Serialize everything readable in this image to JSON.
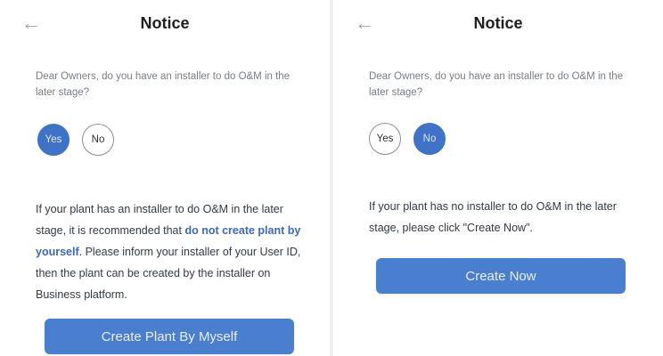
{
  "left": {
    "back_icon": "arrow-left-icon",
    "title": "Notice",
    "question": "Dear Owners, do you have an installer to do O&M in the later stage?",
    "options": {
      "yes": "Yes",
      "no": "No"
    },
    "selected": "Yes",
    "description": {
      "before": "If your plant has an installer to do O&M in the later stage, it is recommended that ",
      "link": "do not create plant by yourself",
      "after": ". Please inform your installer of your User ID, then the plant can be created by the installer on Business platform."
    },
    "button": "Create Plant By Myself"
  },
  "right": {
    "back_icon": "arrow-left-icon",
    "title": "Notice",
    "question": "Dear Owners, do you have an installer to do O&M in the later stage?",
    "options": {
      "yes": "Yes",
      "no": "No"
    },
    "selected": "No",
    "description": "If your plant has no installer to do O&M in the later stage, please click \"Create Now\".",
    "button": "Create Now"
  },
  "colors": {
    "accent": "#3e73c8",
    "button": "#4a7fd0",
    "link": "#3b67c5"
  }
}
